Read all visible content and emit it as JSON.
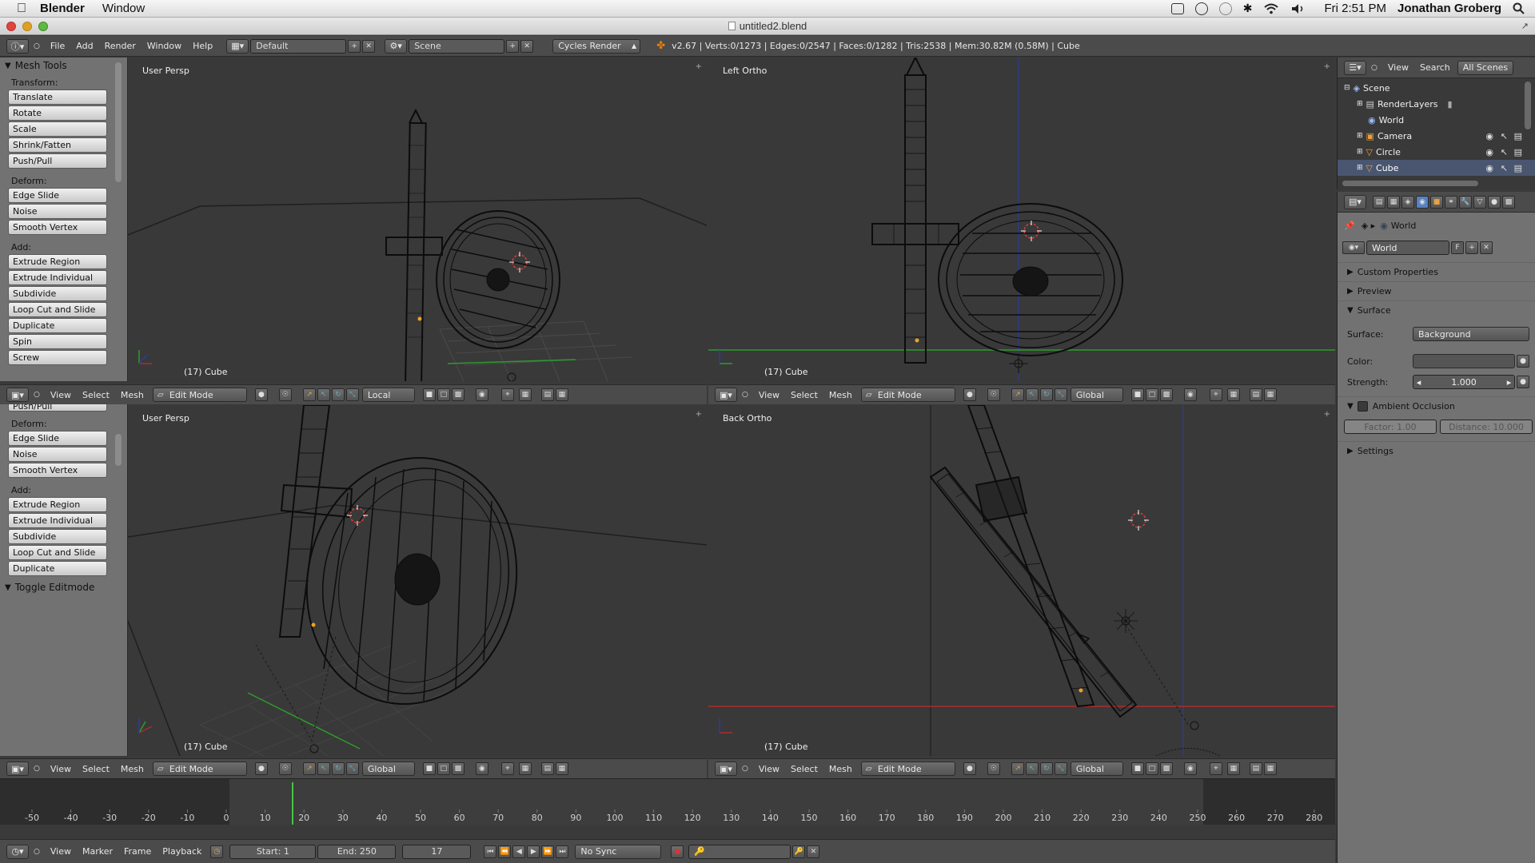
{
  "os_menubar": {
    "app_name": "Blender",
    "menu": [
      "Window"
    ],
    "clock": "Fri 2:51 PM",
    "user": "Jonathan Groberg"
  },
  "window": {
    "title": "untitled2.blend"
  },
  "info_header": {
    "menus": [
      "File",
      "Add",
      "Render",
      "Window",
      "Help"
    ],
    "layout": "Default",
    "scene": "Scene",
    "engine": "Cycles Render",
    "stats": "v2.67 | Verts:0/1273 | Edges:0/2547 | Faces:0/1282 | Tris:2538 | Mem:30.82M (0.58M) | Cube"
  },
  "tool_shelf_top": {
    "title": "Mesh Tools",
    "sections": [
      {
        "label": "Transform:",
        "buttons": [
          "Translate",
          "Rotate",
          "Scale",
          "Shrink/Fatten",
          "Push/Pull"
        ]
      },
      {
        "label": "Deform:",
        "buttons": [
          "Edge Slide",
          "Noise",
          "Smooth Vertex"
        ]
      },
      {
        "label": "Add:",
        "buttons": [
          "Extrude Region",
          "Extrude Individual",
          "Subdivide",
          "Loop Cut and Slide",
          "Duplicate",
          "Spin",
          "Screw"
        ]
      }
    ]
  },
  "tool_shelf_bottom": {
    "cut_button": "Push/Pull",
    "sections": [
      {
        "label": "Deform:",
        "buttons": [
          "Edge Slide",
          "Noise",
          "Smooth Vertex"
        ]
      },
      {
        "label": "Add:",
        "buttons": [
          "Extrude Region",
          "Extrude Individual",
          "Subdivide",
          "Loop Cut and Slide",
          "Duplicate"
        ]
      }
    ],
    "toggle": "Toggle Editmode"
  },
  "viewports": [
    {
      "label": "User Persp",
      "object": "(17) Cube"
    },
    {
      "label": "Left Ortho",
      "object": "(17) Cube"
    },
    {
      "label": "User Persp",
      "object": "(17) Cube"
    },
    {
      "label": "Back Ortho",
      "object": "(17) Cube"
    }
  ],
  "view_headers": [
    {
      "menus": [
        "View",
        "Select",
        "Mesh"
      ],
      "mode": "Edit Mode",
      "orientation": "Local"
    },
    {
      "menus": [
        "View",
        "Select",
        "Mesh"
      ],
      "mode": "Edit Mode",
      "orientation": "Global"
    },
    {
      "menus": [
        "View",
        "Select",
        "Mesh"
      ],
      "mode": "Edit Mode",
      "orientation": "Global"
    },
    {
      "menus": [
        "View",
        "Select",
        "Mesh"
      ],
      "mode": "Edit Mode",
      "orientation": "Global"
    }
  ],
  "outliner": {
    "menus": [
      "View",
      "Search"
    ],
    "filter": "All Scenes",
    "items": [
      "Scene",
      "RenderLayers",
      "World",
      "Camera",
      "Circle",
      "Cube"
    ]
  },
  "properties": {
    "breadcrumb": "World",
    "world_name": "World",
    "fake_user": "F",
    "panels": [
      "Custom Properties",
      "Preview",
      "Surface"
    ],
    "surface_label": "Surface:",
    "surface_value": "Background",
    "color_label": "Color:",
    "strength_label": "Strength:",
    "strength_value": "1.000",
    "ao_label": "Ambient Occlusion",
    "factor": "Factor: 1.00",
    "distance": "Distance: 10.000",
    "settings": "Settings"
  },
  "timeline": {
    "ruler": [
      "-50",
      "-40",
      "-30",
      "-20",
      "-10",
      "0",
      "10",
      "20",
      "30",
      "40",
      "50",
      "60",
      "70",
      "80",
      "90",
      "100",
      "110",
      "120",
      "130",
      "140",
      "150",
      "160",
      "170",
      "180",
      "190",
      "200",
      "210",
      "220",
      "230",
      "240",
      "250",
      "260",
      "270",
      "280"
    ],
    "current_frame": 17,
    "menus": [
      "View",
      "Marker",
      "Frame",
      "Playback"
    ],
    "start": "Start: 1",
    "end": "End: 250",
    "frame": "17",
    "sync": "No Sync"
  },
  "colors": {
    "accent_blue": "#5680c2",
    "x_axis": "#b02a2a",
    "y_axis": "#2e9a2e",
    "z_axis": "#2a3aa8",
    "frame_marker": "#47c447"
  }
}
